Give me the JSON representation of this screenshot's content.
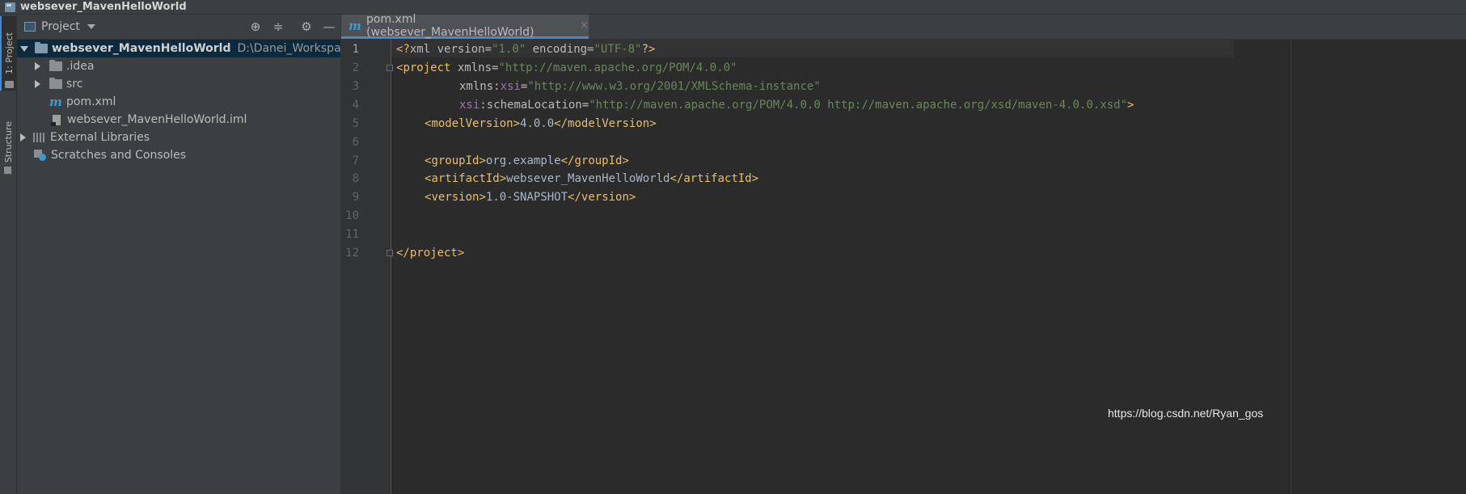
{
  "window": {
    "title": "websever_MavenHelloWorld"
  },
  "toolstrip": {
    "project_tab": "1: Project",
    "structure_tab": "Z: Structure"
  },
  "project_panel": {
    "view_label": "Project",
    "tree": [
      {
        "label": "websever_MavenHelloWorld",
        "path": "D:\\Danei_Workspace\\websever_MavenHelloWorld",
        "icon": "module-folder-icon",
        "expanded": true,
        "selected": true
      },
      {
        "label": ".idea",
        "icon": "folder-icon",
        "expanded": false
      },
      {
        "label": "src",
        "icon": "folder-icon",
        "expanded": false
      },
      {
        "label": "pom.xml",
        "icon": "maven-icon"
      },
      {
        "label": "websever_MavenHelloWorld.iml",
        "icon": "iml-file-icon"
      },
      {
        "label": "External Libraries",
        "icon": "libraries-icon",
        "expanded": false
      },
      {
        "label": "Scratches and Consoles",
        "icon": "scratches-icon"
      }
    ]
  },
  "editor": {
    "tab": {
      "label": "pom.xml (websever_MavenHelloWorld)",
      "close": "×"
    },
    "line_numbers": [
      "1",
      "2",
      "3",
      "4",
      "5",
      "6",
      "7",
      "8",
      "9",
      "10",
      "11",
      "12"
    ],
    "lines": {
      "l1": {
        "p1": "<?",
        "t1": "xml",
        "a1": " version",
        "e1": "=",
        "s1": "\"1.0\"",
        "a2": " encoding",
        "e2": "=",
        "s2": "\"UTF-8\"",
        "p2": "?>"
      },
      "l2": {
        "p1": "<",
        "t1": "project",
        "a1": " xmlns",
        "e1": "=",
        "s1": "\"http://maven.apache.org/POM/4.0.0\""
      },
      "l3": {
        "a1": "xmlns:",
        "n1": "xsi",
        "e1": "=",
        "s1": "\"http://www.w3.org/2001/XMLSchema-instance\""
      },
      "l4": {
        "n1": "xsi",
        "a1": ":schemaLocation",
        "e1": "=",
        "s1": "\"http://maven.apache.org/POM/4.0.0 http://maven.apache.org/xsd/maven-4.0.0.xsd\"",
        "p1": ">"
      },
      "l5": {
        "o": "<",
        "t": "modelVersion",
        "c": ">",
        "v": "4.0.0",
        "o2": "</",
        "t2": "modelVersion",
        "c2": ">"
      },
      "l7": {
        "o": "<",
        "t": "groupId",
        "c": ">",
        "v": "org.example",
        "o2": "</",
        "t2": "groupId",
        "c2": ">"
      },
      "l8": {
        "o": "<",
        "t": "artifactId",
        "c": ">",
        "v": "websever_MavenHelloWorld",
        "o2": "</",
        "t2": "artifactId",
        "c2": ">"
      },
      "l9": {
        "o": "<",
        "t": "version",
        "c": ">",
        "v": "1.0-SNAPSHOT",
        "o2": "</",
        "t2": "version",
        "c2": ">"
      },
      "l12": {
        "o": "</",
        "t": "project",
        "c": ">"
      }
    }
  },
  "watermark": "https://blog.csdn.net/Ryan_gos"
}
